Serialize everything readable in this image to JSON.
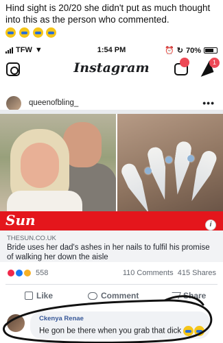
{
  "caption": {
    "text": "Hind sight is 20/20 she didn't put as much thought into this as the person who commented.",
    "emoji_icons": [
      "laughing-crying-emoji",
      "laughing-crying-emoji",
      "laughing-crying-emoji",
      "laughing-crying-emoji"
    ]
  },
  "status_bar": {
    "carrier": "TFW",
    "time": "1:54 PM",
    "battery": "70%"
  },
  "instagram_header": {
    "logo_text": "Instagram",
    "igtv_badge": "",
    "direct_badge": "1"
  },
  "post": {
    "username": "queenofbling_",
    "more_label": "•••"
  },
  "link_card": {
    "publisher": "Sun",
    "info_label": "i",
    "domain": "THESUN.CO.UK",
    "headline": "Bride uses her dad's ashes in her nails to fulfil his promise of walking her down the aisle"
  },
  "engagement": {
    "reactions_count": "558",
    "comments_count": "110 Comments",
    "shares_count": "415 Shares",
    "reaction_colors": [
      "#f0284a",
      "#1877f2",
      "#f7b125"
    ]
  },
  "actions": {
    "like_label": "Like",
    "comment_label": "Comment",
    "share_label": "Share"
  },
  "comment": {
    "author": "Ckenya Renae",
    "text": "He gon be there when you grab that dick"
  },
  "colors": {
    "sun_red": "#e4161c",
    "link_bg": "#f2f3f5",
    "notification_red": "#ed4956"
  }
}
